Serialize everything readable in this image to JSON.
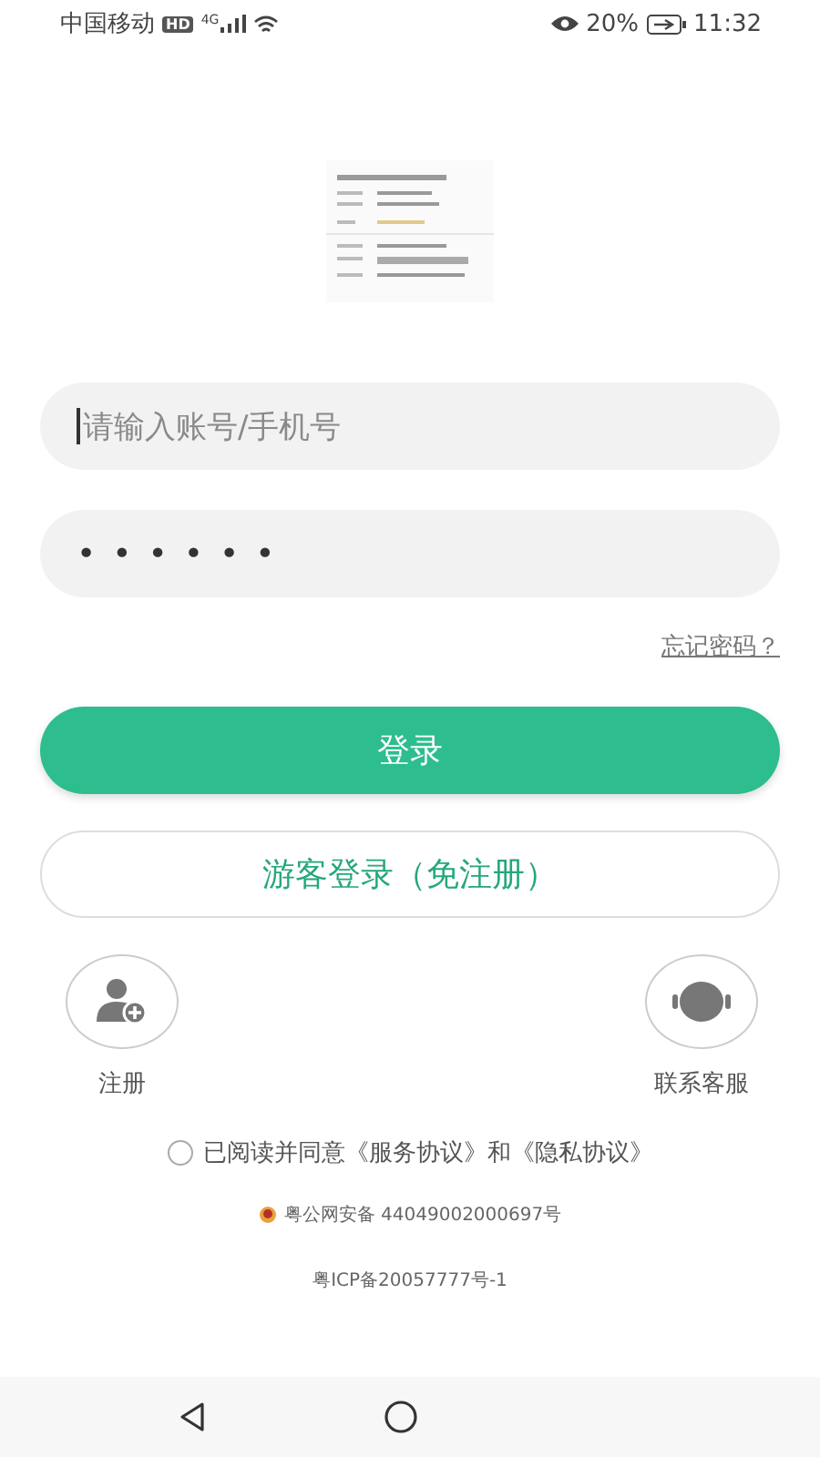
{
  "status_bar": {
    "carrier": "中国移动",
    "hd": "HD",
    "network": "4G",
    "battery": "20%",
    "time": "11:32"
  },
  "account_field": {
    "placeholder": "请输入账号/手机号",
    "focused": true
  },
  "password_field": {
    "value": "••••••"
  },
  "forgot_password": "忘记密码？",
  "login_button": "登录",
  "guest_button": "游客登录（免注册）",
  "shortcuts": [
    {
      "kind": "register",
      "label": "注册"
    },
    {
      "kind": "support",
      "label": "联系客服"
    }
  ],
  "agreement": {
    "checked": false,
    "text": "已阅读并同意《服务协议》和《隐私协议》"
  },
  "police_record": "粤公网安备 44049002000697号",
  "icp_record": "粤ICP备20057777号-1"
}
